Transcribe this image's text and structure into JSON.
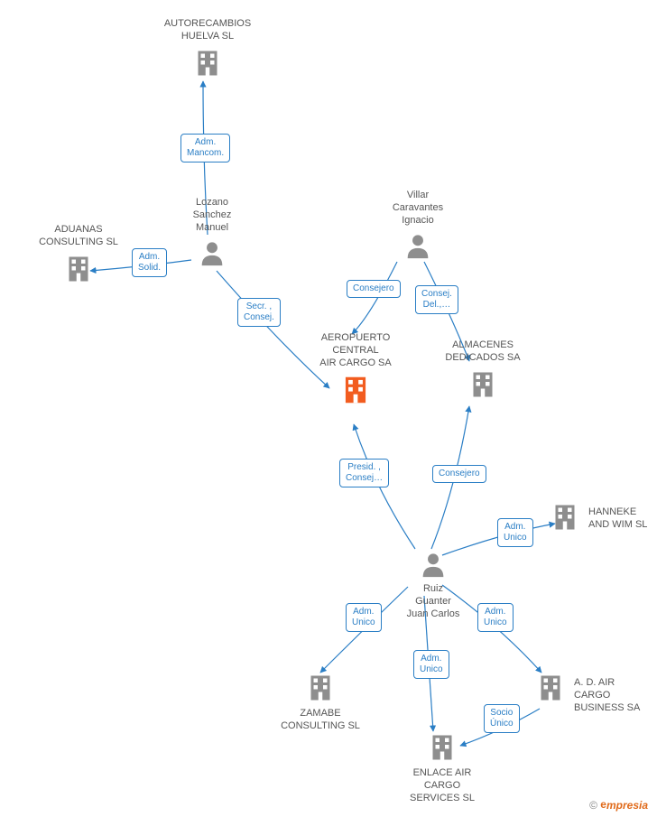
{
  "central_company": "AEROPUERTO\nCENTRAL\nAIR CARGO SA",
  "people": {
    "lozano": "Lozano\nSanchez\nManuel",
    "villar": "Villar\nCaravantes\nIgnacio",
    "ruiz": "Ruiz\nGuanter\nJuan Carlos"
  },
  "companies": {
    "autorecambios": "AUTORECAMBIOS\nHUELVA SL",
    "aduanas": "ADUANAS\nCONSULTING SL",
    "almacenes": "ALMACENES\nDEDICADOS SA",
    "hanneke": "HANNEKE\nAND WIM SL",
    "ad_cargo": "A. D. AIR\nCARGO\nBUSINESS SA",
    "enlace": "ENLACE AIR\nCARGO\nSERVICES SL",
    "zamabe": "ZAMABE\nCONSULTING SL"
  },
  "relations": {
    "adm_mancom": "Adm.\nMancom.",
    "adm_solid": "Adm.\nSolid.",
    "secr_consej": "Secr. ,\nConsej.",
    "consejero": "Consejero",
    "consej_del": "Consej.\nDel.,…",
    "presid_consej": "Presid. ,\nConsej…",
    "adm_unico": "Adm.\nUnico",
    "socio_unico": "Socio\nÚnico"
  },
  "copyright_symbol": "©",
  "brand_first": "e",
  "brand_rest": "mpresia"
}
